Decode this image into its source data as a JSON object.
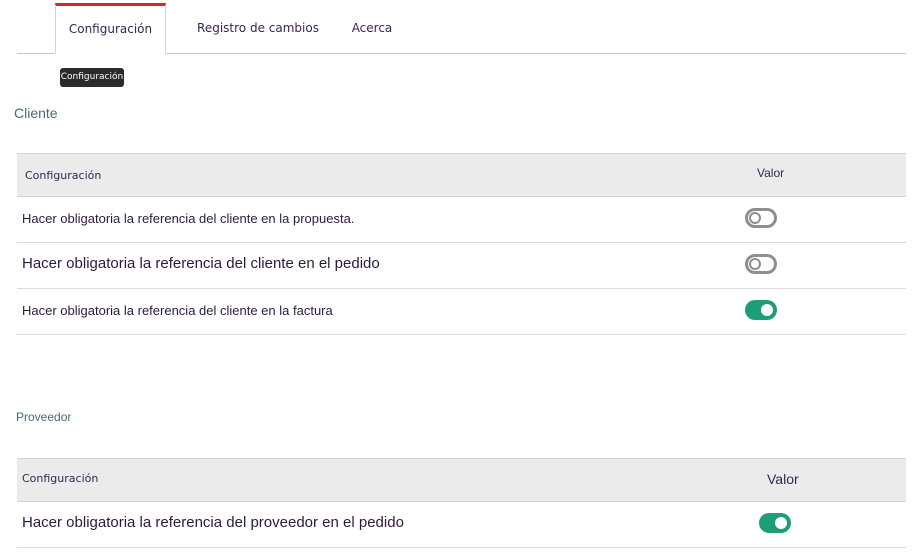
{
  "tabs": [
    {
      "label": "Configuración",
      "active": true
    },
    {
      "label": "Registro de cambios",
      "active": false
    },
    {
      "label": "Acerca",
      "active": false
    }
  ],
  "tooltip": "Configuración",
  "client_section": {
    "title": "Cliente",
    "header": {
      "config": "Configuración",
      "value": "Valor"
    },
    "rows": [
      {
        "label": "Hacer obligatoria la referencia del cliente en la propuesta.",
        "enabled": false
      },
      {
        "label": "Hacer obligatoria la referencia del cliente en el pedido",
        "enabled": false
      },
      {
        "label": "Hacer obligatoria la referencia del cliente en la factura",
        "enabled": true
      }
    ]
  },
  "vendor_section": {
    "title": "Proveedor",
    "header": {
      "config": "Configuración",
      "value": "Valor"
    },
    "rows": [
      {
        "label": "Hacer obligatoria la referencia del proveedor en el pedido",
        "enabled": true
      }
    ]
  },
  "colors": {
    "accent": "#e0232b",
    "toggle_on": "#1e9e76",
    "toggle_off": "#8f8f8f",
    "section_title": "#4a6b78"
  }
}
